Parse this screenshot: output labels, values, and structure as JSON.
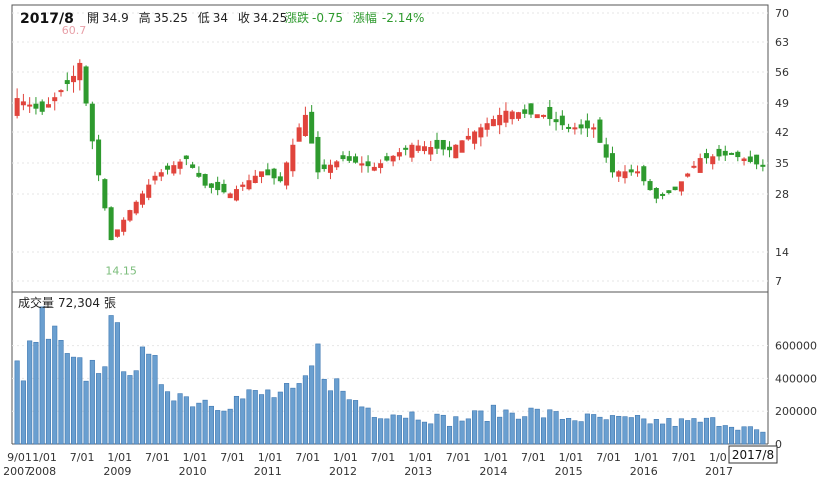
{
  "header": {
    "period": "2017/8",
    "open_label": "開",
    "open": "34.9",
    "high_label": "高",
    "high": "35.25",
    "low_label": "低",
    "low": "34",
    "close_label": "收",
    "close": "34.25",
    "change_label": "漲跌",
    "change": "-0.75",
    "pct_label": "漲幅",
    "pct": "-2.14%"
  },
  "volume_header": {
    "label": "成交量",
    "value": "72,304",
    "unit": "張"
  },
  "cursor_label": "2017/8",
  "colors": {
    "up": "#e0443c",
    "down": "#2e9a2e",
    "volume": "#6a9fd0",
    "max_marker": "#e8a0a8",
    "min_marker": "#7bbd7b"
  },
  "chart_data": [
    {
      "type": "candlestick",
      "x_range": [
        "2007-09",
        "2017-08"
      ],
      "y_ticks": [
        7,
        14,
        28,
        35,
        42,
        49,
        56,
        63,
        70
      ],
      "max_marker": {
        "label": "60.7",
        "date": "2008-07",
        "value": 60.7
      },
      "min_marker": {
        "label": "14.15",
        "date": "2009-01",
        "value": 14.15
      },
      "keypoints": [
        {
          "date": "2007-09",
          "close": 50
        },
        {
          "date": "2008-01",
          "close": 47
        },
        {
          "date": "2008-06",
          "close": 55
        },
        {
          "date": "2008-07",
          "close": 58
        },
        {
          "date": "2008-09",
          "close": 40
        },
        {
          "date": "2008-12",
          "close": 17
        },
        {
          "date": "2009-03",
          "close": 24
        },
        {
          "date": "2009-07",
          "close": 32
        },
        {
          "date": "2009-12",
          "close": 36
        },
        {
          "date": "2010-03",
          "close": 30
        },
        {
          "date": "2010-07",
          "close": 28
        },
        {
          "date": "2010-12",
          "close": 33
        },
        {
          "date": "2011-03",
          "close": 31
        },
        {
          "date": "2011-06",
          "close": 43
        },
        {
          "date": "2011-07",
          "close": 46
        },
        {
          "date": "2011-09",
          "close": 33
        },
        {
          "date": "2012-01",
          "close": 36
        },
        {
          "date": "2012-06",
          "close": 34
        },
        {
          "date": "2012-12",
          "close": 39
        },
        {
          "date": "2013-06",
          "close": 38
        },
        {
          "date": "2013-12",
          "close": 44
        },
        {
          "date": "2014-03",
          "close": 47
        },
        {
          "date": "2014-09",
          "close": 46
        },
        {
          "date": "2015-01",
          "close": 43
        },
        {
          "date": "2015-05",
          "close": 43
        },
        {
          "date": "2015-08",
          "close": 33
        },
        {
          "date": "2015-12",
          "close": 33
        },
        {
          "date": "2016-03",
          "close": 27
        },
        {
          "date": "2016-06",
          "close": 29
        },
        {
          "date": "2016-10",
          "close": 36
        },
        {
          "date": "2017-03",
          "close": 37
        },
        {
          "date": "2017-08",
          "close": 34.25
        }
      ]
    },
    {
      "type": "bar",
      "title": "成交量",
      "y_ticks": [
        0,
        200000,
        400000,
        600000
      ],
      "y_tick_labels": [
        "0",
        "200000",
        "400000",
        "600000"
      ],
      "volume_keypoints": [
        {
          "date": "2007-09",
          "value": 440000
        },
        {
          "date": "2007-11",
          "value": 520000
        },
        {
          "date": "2008-01",
          "value": 720000
        },
        {
          "date": "2008-06",
          "value": 440000
        },
        {
          "date": "2008-09",
          "value": 460000
        },
        {
          "date": "2008-12",
          "value": 640000
        },
        {
          "date": "2009-03",
          "value": 530000
        },
        {
          "date": "2009-07",
          "value": 440000
        },
        {
          "date": "2009-12",
          "value": 280000
        },
        {
          "date": "2010-06",
          "value": 260000
        },
        {
          "date": "2010-12",
          "value": 300000
        },
        {
          "date": "2011-06",
          "value": 300000
        },
        {
          "date": "2011-09",
          "value": 530000
        },
        {
          "date": "2012-01",
          "value": 300000
        },
        {
          "date": "2012-06",
          "value": 200000
        },
        {
          "date": "2013-01",
          "value": 180000
        },
        {
          "date": "2013-06",
          "value": 140000
        },
        {
          "date": "2014-01",
          "value": 190000
        },
        {
          "date": "2014-06",
          "value": 200000
        },
        {
          "date": "2015-01",
          "value": 160000
        },
        {
          "date": "2015-06",
          "value": 150000
        },
        {
          "date": "2016-01",
          "value": 140000
        },
        {
          "date": "2016-06",
          "value": 130000
        },
        {
          "date": "2017-01",
          "value": 140000
        },
        {
          "date": "2017-08",
          "value": 72304
        }
      ]
    }
  ],
  "x_axis": {
    "labels": [
      {
        "text": "9/01",
        "date": "2007-09"
      },
      {
        "text": "1/01",
        "date": "2008-01"
      },
      {
        "text": "7/01",
        "date": "2008-07"
      },
      {
        "text": "1/01",
        "date": "2009-01"
      },
      {
        "text": "7/01",
        "date": "2009-07"
      },
      {
        "text": "1/01",
        "date": "2010-01"
      },
      {
        "text": "7/01",
        "date": "2010-07"
      },
      {
        "text": "1/01",
        "date": "2011-01"
      },
      {
        "text": "7/01",
        "date": "2011-07"
      },
      {
        "text": "1/01",
        "date": "2012-01"
      },
      {
        "text": "7/01",
        "date": "2012-07"
      },
      {
        "text": "1/01",
        "date": "2013-01"
      },
      {
        "text": "7/01",
        "date": "2013-07"
      },
      {
        "text": "1/01",
        "date": "2014-01"
      },
      {
        "text": "7/01",
        "date": "2014-07"
      },
      {
        "text": "1/01",
        "date": "2015-01"
      },
      {
        "text": "7/01",
        "date": "2015-07"
      },
      {
        "text": "1/01",
        "date": "2016-01"
      },
      {
        "text": "7/01",
        "date": "2016-07"
      },
      {
        "text": "1/0",
        "date": "2017-01"
      }
    ],
    "years": [
      {
        "text": "2007",
        "date": "2007-09"
      },
      {
        "text": "2008",
        "date": "2008-01"
      },
      {
        "text": "2009",
        "date": "2009-01"
      },
      {
        "text": "2010",
        "date": "2010-01"
      },
      {
        "text": "2011",
        "date": "2011-01"
      },
      {
        "text": "2012",
        "date": "2012-01"
      },
      {
        "text": "2013",
        "date": "2013-01"
      },
      {
        "text": "2014",
        "date": "2014-01"
      },
      {
        "text": "2015",
        "date": "2015-01"
      },
      {
        "text": "2016",
        "date": "2016-01"
      },
      {
        "text": "2017",
        "date": "2017-01"
      }
    ]
  }
}
